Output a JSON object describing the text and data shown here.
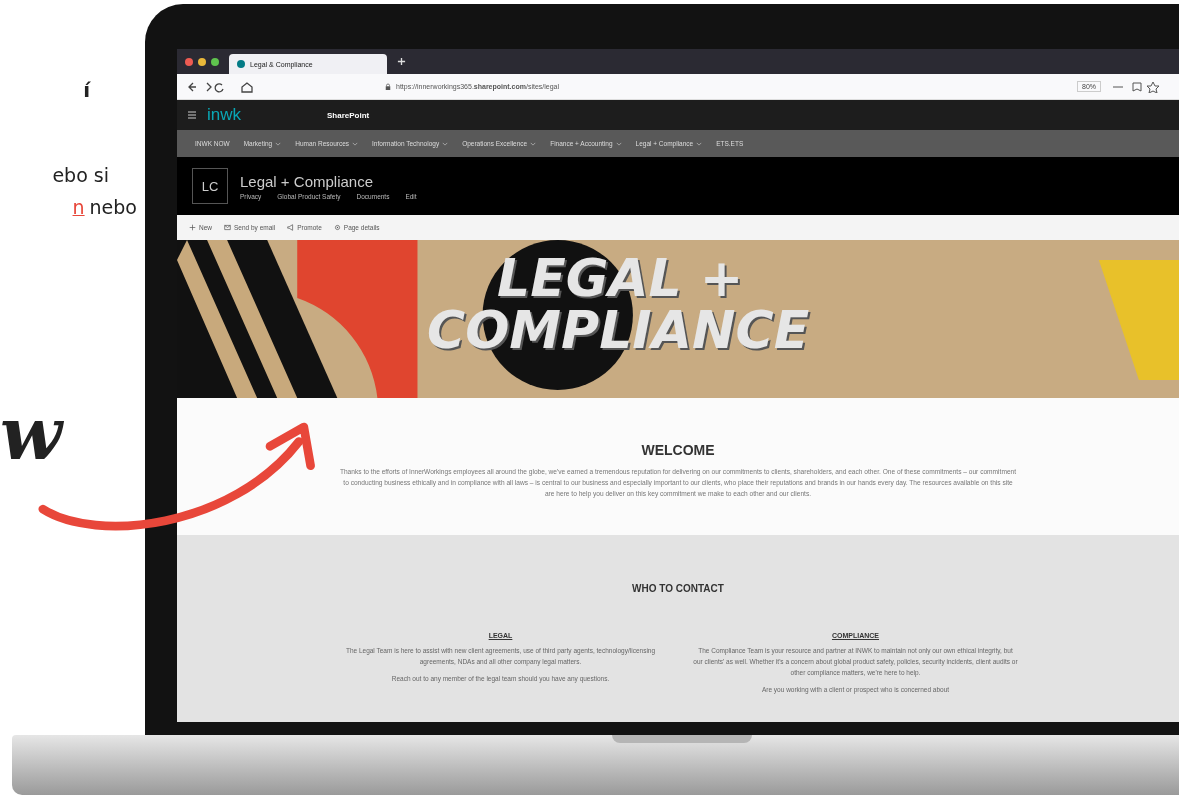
{
  "promo": {
    "heading_fragment": "í",
    "line_1_fragment": "ebo si",
    "link_fragment": "n",
    "line_2_fragment": "nebo",
    "script_fragment": "w"
  },
  "browser": {
    "tabs": [
      {
        "title": "Legal & Compliance",
        "selected": true
      }
    ],
    "url": "https://innerworkings365.**sharepoint.com**/sites/legal",
    "zoom": "80%"
  },
  "suite_bar": {
    "logo": "inwk",
    "app": "SharePoint"
  },
  "nav": [
    {
      "label": "INWK NOW",
      "has_menu": false
    },
    {
      "label": "Marketing",
      "has_menu": true
    },
    {
      "label": "Human Resources",
      "has_menu": true
    },
    {
      "label": "Information Technology",
      "has_menu": true
    },
    {
      "label": "Operations Excellence",
      "has_menu": true
    },
    {
      "label": "Finance + Accounting",
      "has_menu": true
    },
    {
      "label": "Legal + Compliance",
      "has_menu": true
    },
    {
      "label": "ETS.ETS",
      "has_menu": false
    }
  ],
  "site": {
    "initials": "LC",
    "title": "Legal + Compliance",
    "links": [
      "Privacy",
      "Global Product Safety",
      "Documents",
      "Edit"
    ]
  },
  "commands": [
    {
      "kind": "new",
      "label": "New"
    },
    {
      "kind": "email",
      "label": "Send by email"
    },
    {
      "kind": "promote",
      "label": "Promote"
    },
    {
      "kind": "details",
      "label": "Page details"
    }
  ],
  "banner": {
    "line_1": "LEGAL +",
    "line_2": "COMPLIANCE"
  },
  "welcome": {
    "title": "WELCOME",
    "text": "Thanks to the efforts of InnerWorkings employees all around the globe, we've earned a tremendous reputation for delivering on our commitments to clients, shareholders, and each other. One of these commitments – our commitment to conducting business ethically and in compliance with all laws – is central to our business and especially important to our clients, who place their reputations and brands in our hands every day. The resources available on this site are here to help you deliver on this key commitment we make to each other and our clients."
  },
  "contact": {
    "title": "WHO TO CONTACT",
    "columns": [
      {
        "heading": "LEGAL",
        "paragraphs": [
          "The Legal Team is here to assist with new client agreements, use of third party agents, technology/licensing agreements, NDAs and all other company legal matters.",
          "Reach out to any member of the legal team should you have any questions."
        ]
      },
      {
        "heading": "COMPLIANCE",
        "paragraphs": [
          "The Compliance Team is your resource and partner at INWK to maintain not only our own ethical integrity, but our clients' as well. Whether it's a concern about global product safety, policies, security incidents, client audits or other compliance matters, we're here to help.",
          "Are you working with a client or prospect who is concerned about"
        ]
      }
    ]
  }
}
